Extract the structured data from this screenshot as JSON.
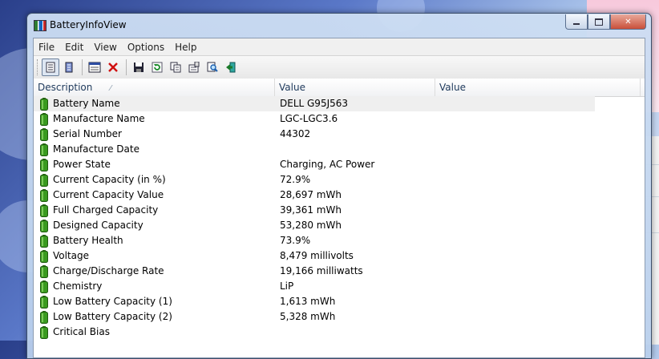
{
  "window": {
    "title": "BatteryInfoView"
  },
  "menu": [
    "File",
    "Edit",
    "View",
    "Options",
    "Help"
  ],
  "columns": {
    "description": "Description",
    "value1": "Value",
    "value2": "Value"
  },
  "rows": [
    {
      "desc": "Battery Name",
      "value": "DELL G95J563"
    },
    {
      "desc": "Manufacture Name",
      "value": "LGC-LGC3.6"
    },
    {
      "desc": "Serial Number",
      "value": "44302"
    },
    {
      "desc": "Manufacture Date",
      "value": ""
    },
    {
      "desc": "Power State",
      "value": "Charging, AC Power"
    },
    {
      "desc": "Current Capacity (in %)",
      "value": "72.9%"
    },
    {
      "desc": "Current Capacity Value",
      "value": "28,697 mWh"
    },
    {
      "desc": "Full Charged Capacity",
      "value": "39,361 mWh"
    },
    {
      "desc": "Designed Capacity",
      "value": "53,280 mWh"
    },
    {
      "desc": "Battery Health",
      "value": "73.9%"
    },
    {
      "desc": "Voltage",
      "value": "8,479 millivolts"
    },
    {
      "desc": "Charge/Discharge Rate",
      "value": "19,166 milliwatts"
    },
    {
      "desc": "Chemistry",
      "value": "LiP"
    },
    {
      "desc": "Low Battery Capacity (1)",
      "value": "1,613 mWh"
    },
    {
      "desc": "Low Battery Capacity (2)",
      "value": "5,328 mWh"
    },
    {
      "desc": "Critical Bias",
      "value": ""
    }
  ],
  "toolbar_icons": [
    "battery-info-icon",
    "battery-log-icon",
    "properties-window-icon",
    "delete-icon",
    "save-icon",
    "refresh-icon",
    "copy-icon",
    "properties-icon",
    "find-icon",
    "exit-icon"
  ],
  "colors": {
    "battery_green": "#3a9a1f",
    "selection_gray": "#efefef",
    "header_text": "#1e395b"
  }
}
